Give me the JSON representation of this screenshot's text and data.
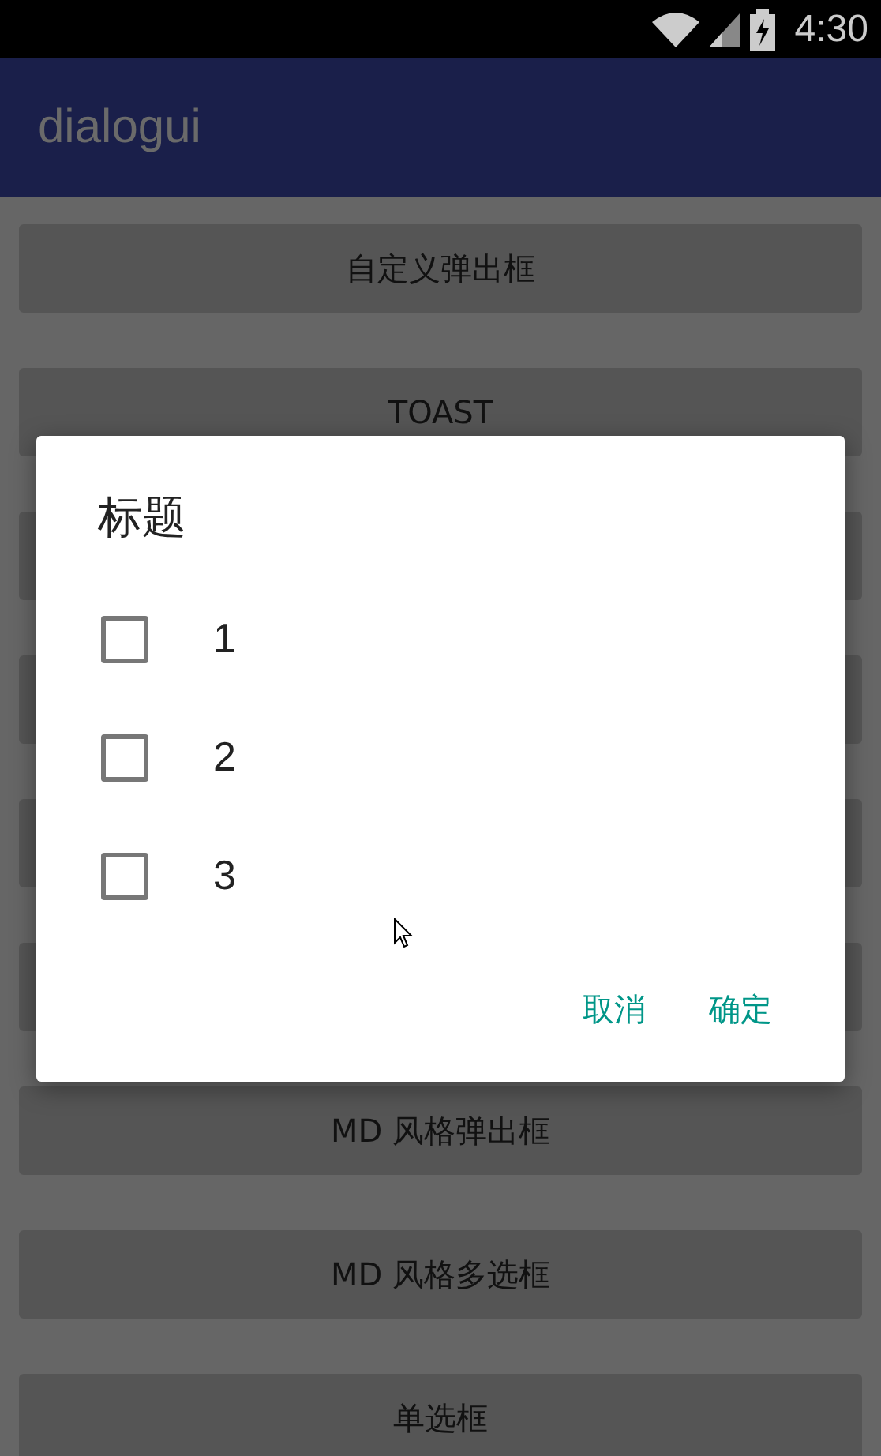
{
  "status_bar": {
    "time": "4:30"
  },
  "app_bar": {
    "title": "dialogui"
  },
  "buttons": [
    {
      "label": "自定义弹出框"
    },
    {
      "label": "TOAST"
    },
    {
      "covered": true
    },
    {
      "covered": true
    },
    {
      "covered": true
    },
    {
      "covered": true
    },
    {
      "label": "MD 风格弹出框"
    },
    {
      "label": "MD 风格多选框"
    },
    {
      "label": "单选框"
    }
  ],
  "dialog": {
    "title": "标题",
    "options": [
      {
        "label": "1",
        "checked": false
      },
      {
        "label": "2",
        "checked": false
      },
      {
        "label": "3",
        "checked": false
      }
    ],
    "actions": [
      {
        "label": "取消"
      },
      {
        "label": "确定"
      }
    ]
  }
}
